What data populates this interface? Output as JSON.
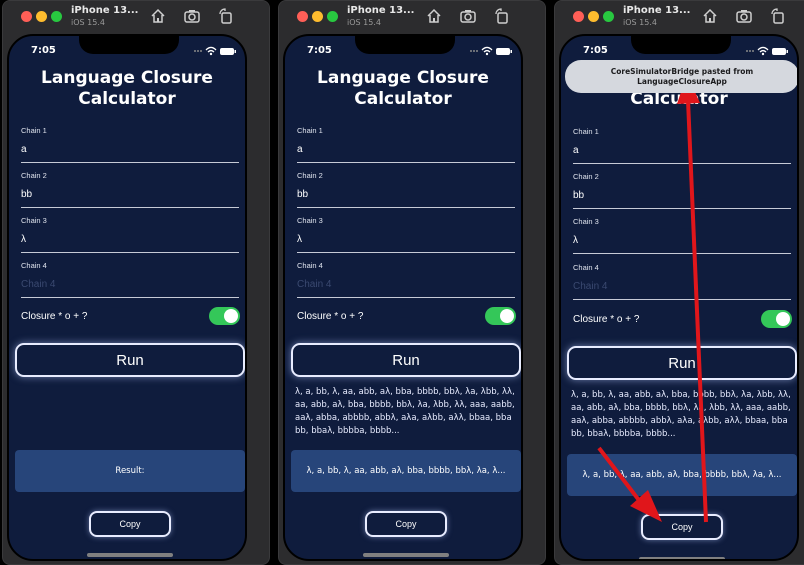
{
  "simulator": {
    "device_name": "iPhone 13...",
    "os_version": "iOS 15.4",
    "toolbar_icons": [
      "home-icon",
      "screenshot-icon",
      "rotate-icon"
    ]
  },
  "status_bar": {
    "time": "7:05"
  },
  "app": {
    "title_line1": "Language Closure",
    "title_line2": "Calculator",
    "chains": [
      {
        "label": "Chain 1",
        "value": "a"
      },
      {
        "label": "Chain 2",
        "value": "bb"
      },
      {
        "label": "Chain 3",
        "value": "λ"
      },
      {
        "label": "Chain 4",
        "value": "",
        "placeholder": "Chain 4"
      }
    ],
    "closure_toggle": {
      "label": "Closure * o + ?",
      "on": true
    },
    "run_label": "Run",
    "copy_label": "Copy"
  },
  "screens": [
    {
      "output": "",
      "result": "Result:"
    },
    {
      "output": "λ, a, bb, λ, aa, abb, aλ, bba, bbbb, bbλ, λa, λbb, λλ, aa, abb, aλ, bba, bbbb, bbλ, λa, λbb, λλ, aaa, aabb, aaλ, abba, abbbb, abbλ, aλa, aλbb, aλλ, bbaa, bbabb, bbaλ, bbbba, bbbb...",
      "result": "λ, a, bb, λ, aa, abb, aλ, bba, bbbb, bbλ, λa, λ..."
    },
    {
      "output": "λ, a, bb, λ, aa, abb, aλ, bba, bbbb, bbλ, λa, λbb, λλ, aa, abb, aλ, bba, bbbb, bbλ, λa, λbb, λλ, aaa, aabb, aaλ, abba, abbbb, abbλ, aλa, aλbb, aλλ, bbaa, bbabb, bbaλ, bbbba, bbbb...",
      "result": "λ, a, bb, λ, aa, abb, aλ, bba, bbbb, bbλ, λa, λ...",
      "banner_line1": "CoreSimulatorBridge pasted from",
      "banner_line2": "LanguageClosureApp"
    }
  ],
  "colors": {
    "app_background": "#0f1c3d",
    "result_box": "#27457a",
    "toggle_on": "#34c759",
    "annotation_arrow": "#e0161b"
  }
}
